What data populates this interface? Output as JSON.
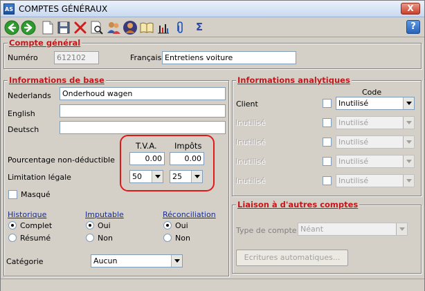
{
  "window": {
    "title": "COMPTES GÉNÉRAUX",
    "app_badge": "AS",
    "close_glyph": "X",
    "help_glyph": "?"
  },
  "colors": {
    "section_title": "#c0191c",
    "link_label": "#1b2d8a",
    "highlight": "#e01818"
  },
  "toolbar": {
    "icons": [
      "back-icon",
      "forward-icon",
      "new-document-icon",
      "save-icon",
      "delete-icon",
      "search-document-icon",
      "users-icon",
      "user-icon",
      "book-icon",
      "chart-icon",
      "attach-icon",
      "sum-icon"
    ],
    "sum_glyph": "Σ"
  },
  "compte_general": {
    "title": "Compte général",
    "numero_label": "Numéro",
    "numero_value": "612102",
    "francais_label": "Français",
    "francais_value": "Entretiens voiture"
  },
  "base": {
    "title": "Informations de base",
    "nederlands_label": "Nederlands",
    "nederlands_value": "Onderhoud wagen",
    "english_label": "English",
    "english_value": "",
    "deutsch_label": "Deutsch",
    "deutsch_value": "",
    "tva_header": "T.V.A.",
    "impots_header": "Impôts",
    "pourcentage_label": "Pourcentage non-déductible",
    "pourcentage_tva": "0.00",
    "pourcentage_impots": "0.00",
    "limitation_label": "Limitation légale",
    "limitation_tva": "50",
    "limitation_impots": "25",
    "masque_label": "Masqué",
    "historique_label": "Historique",
    "historique_opt1": "Complet",
    "historique_opt2": "Résumé",
    "imputable_label": "Imputable",
    "imputable_opt1": "Oui",
    "imputable_opt2": "Non",
    "reconciliation_label": "Réconciliation",
    "reconciliation_opt1": "Oui",
    "reconciliation_opt2": "Non",
    "categorie_label": "Catégorie",
    "categorie_value": "Aucun"
  },
  "analytiques": {
    "title": "Informations analytiques",
    "code_header": "Code",
    "rows": [
      {
        "label": "Client",
        "value": "Inutilisé",
        "enabled": true
      },
      {
        "label": "Inutilisé",
        "value": "Inutilisé",
        "enabled": false
      },
      {
        "label": "Inutilisé",
        "value": "Inutilisé",
        "enabled": false
      },
      {
        "label": "Inutilisé",
        "value": "Inutilisé",
        "enabled": false
      },
      {
        "label": "Inutilisé",
        "value": "Inutilisé",
        "enabled": false
      }
    ]
  },
  "liaison": {
    "title": "Liaison à d'autres comptes",
    "type_label": "Type de compte",
    "type_value": "Néant",
    "ecritures_button": "Ecritures automatiques..."
  }
}
